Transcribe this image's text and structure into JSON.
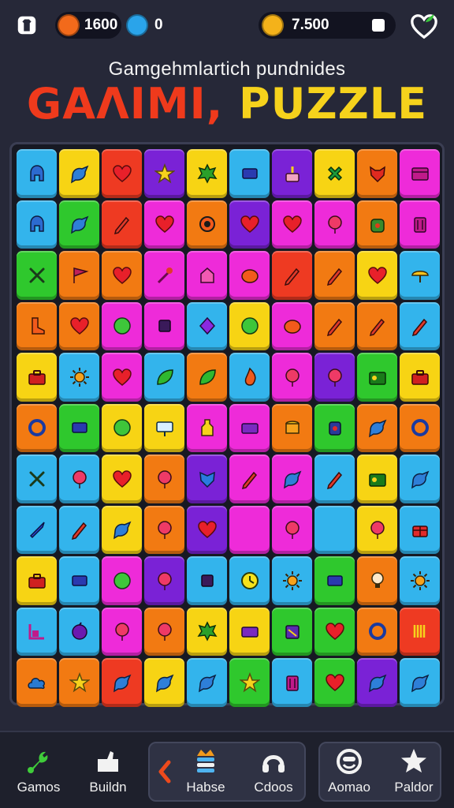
{
  "header": {
    "currency1_value": "1600",
    "currency2_value": "0",
    "coins_value": "7.500",
    "currency1_color": "#f26a1b",
    "currency2_color": "#2aa4ea",
    "coin_color": "#f4b21a",
    "left_icon": "shirt-icon",
    "right_icon": "heart-sprout-icon"
  },
  "title": {
    "subtitle": "Gamgehmlartich pundnides",
    "line1": "GAΛIMI,",
    "line2": "PUZZLE"
  },
  "palette": {
    "B": "#33b4ec",
    "Y": "#f7d414",
    "R": "#ee3a22",
    "P": "#7a22d6",
    "M": "#ee2bd9",
    "G": "#2fc82d",
    "O": "#f27a12"
  },
  "board": {
    "rows": [
      [
        "B",
        "Y",
        "R",
        "P",
        "Y",
        "B",
        "P",
        "Y",
        "O",
        "M"
      ],
      [
        "B",
        "G",
        "R",
        "M",
        "O",
        "P",
        "M",
        "M",
        "O",
        "M"
      ],
      [
        "G",
        "O",
        "O",
        "M",
        "M",
        "M",
        "R",
        "O",
        "Y",
        "B"
      ],
      [
        "O",
        "O",
        "M",
        "M",
        "B",
        "Y",
        "M",
        "O",
        "O",
        "B"
      ],
      [
        "Y",
        "B",
        "M",
        "B",
        "O",
        "B",
        "M",
        "P",
        "G",
        "Y"
      ],
      [
        "O",
        "G",
        "Y",
        "Y",
        "M",
        "M",
        "O",
        "G",
        "O",
        "O"
      ],
      [
        "B",
        "B",
        "Y",
        "O",
        "P",
        "M",
        "M",
        "B",
        "Y",
        "B"
      ],
      [
        "B",
        "B",
        "Y",
        "O",
        "P",
        "M",
        "M",
        "B",
        "Y",
        "B"
      ],
      [
        "Y",
        "B",
        "M",
        "P",
        "B",
        "B",
        "B",
        "G",
        "O",
        "B"
      ],
      [
        "B",
        "B",
        "M",
        "O",
        "Y",
        "Y",
        "G",
        "G",
        "O",
        "R"
      ],
      [
        "O",
        "O",
        "R",
        "Y",
        "B",
        "G",
        "B",
        "G",
        "P",
        "B"
      ]
    ],
    "icons": [
      [
        "helmet",
        "bird",
        "heart",
        "star",
        "splat",
        "rect",
        "cake",
        "cross",
        "fox",
        "chest"
      ],
      [
        "helmet",
        "bird",
        "pencil",
        "heart",
        "eye",
        "heart",
        "heart",
        "balloon",
        "pot",
        "jar"
      ],
      [
        "tongs",
        "flag",
        "heart",
        "wand",
        "house",
        "blob",
        "pencil",
        "pencil",
        "heart",
        "umbrella"
      ],
      [
        "boot",
        "heart",
        "circle",
        "square",
        "diamond",
        "circle",
        "blob",
        "pencil",
        "pencil",
        "pencil"
      ],
      [
        "suitcase",
        "sun",
        "heart",
        "leaf",
        "leaf",
        "flame",
        "balloon",
        "balloon",
        "radio",
        "suitcase"
      ],
      [
        "ring",
        "rect",
        "circle",
        "sign",
        "bottle",
        "tray",
        "coins",
        "lantern",
        "bird",
        "ring"
      ],
      [
        "tongs",
        "balloon",
        "heart",
        "balloon",
        "shield",
        "pencil",
        "bird",
        "pencil",
        "radio",
        "bird"
      ],
      [
        "rocket",
        "pencil",
        "bird",
        "balloon",
        "heart",
        "blank",
        "balloon",
        "blank",
        "balloon",
        "gift"
      ],
      [
        "suitcase",
        "rect",
        "circle",
        "balloon",
        "square",
        "clock",
        "sun",
        "rect",
        "lamp",
        "sun"
      ],
      [
        "corner",
        "apple",
        "balloon",
        "balloon",
        "splat",
        "tray",
        "bag",
        "heart",
        "ring",
        "bars"
      ],
      [
        "cloud",
        "star",
        "bird",
        "bird",
        "bird",
        "star",
        "jar",
        "heart",
        "bird",
        "bird"
      ]
    ]
  },
  "nav": {
    "left": [
      {
        "label": "Gamos",
        "icon": "wrench-icon"
      },
      {
        "label": "Buildn",
        "icon": "hand-icon"
      }
    ],
    "center": [
      {
        "label": "Habse",
        "icon": "crown-stack-icon"
      },
      {
        "label": "Cdoos",
        "icon": "headset-icon"
      }
    ],
    "right": [
      {
        "label": "Aomao",
        "icon": "smile-icon"
      },
      {
        "label": "Paldor",
        "icon": "star-icon"
      }
    ],
    "back_icon": "chevron-left-icon"
  }
}
